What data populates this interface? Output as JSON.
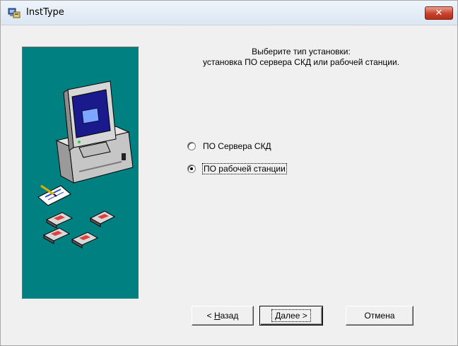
{
  "window": {
    "title": "InstType",
    "close_glyph": "✕"
  },
  "instruction": {
    "line1": "Выберите тип установки:",
    "line2": "установка ПО сервера СКД или рабочей станции."
  },
  "options": [
    {
      "label": "ПО Сервера СКД",
      "checked": false
    },
    {
      "label": "ПО рабочей станции",
      "checked": true
    }
  ],
  "buttons": {
    "back": {
      "prefix": "< ",
      "mnemonic": "Н",
      "rest": "азад"
    },
    "next": {
      "mnemonic": "Д",
      "rest": "алее",
      "suffix": " >"
    },
    "cancel": {
      "label": "Отмена"
    }
  },
  "colors": {
    "panel": "#008080",
    "close_button": "#c7412a"
  }
}
